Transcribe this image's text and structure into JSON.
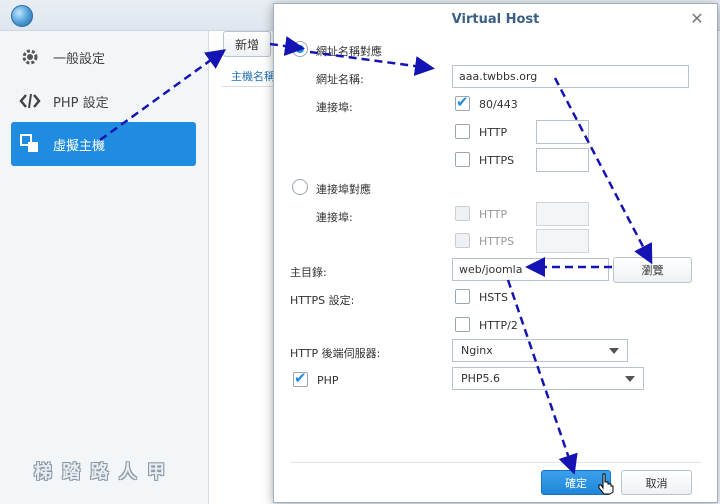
{
  "sidebar": {
    "items": [
      {
        "label": "一般設定",
        "icon": "gear-icon"
      },
      {
        "label": "PHP 設定",
        "icon": "code-icon"
      },
      {
        "label": "虛擬主機",
        "icon": "virtual-host-icon"
      }
    ]
  },
  "main": {
    "add_button": "新增",
    "column_header": "主機名稱"
  },
  "watermark": "梯 踏 路 人 甲",
  "dialog": {
    "title": "Virtual Host",
    "hostname_mode_label": "網址名稱對應",
    "hostname_label": "網址名稱:",
    "hostname_value": "aaa.twbbs.org",
    "port_label": "連接埠:",
    "port_8043": "80/443",
    "http": "HTTP",
    "https": "HTTPS",
    "port_mode_label": "連接埠對應",
    "port_label2": "連接埠:",
    "http2": "HTTP",
    "https2": "HTTPS",
    "docroot_label": "主目錄:",
    "docroot_value": "web/joomla",
    "browse_button": "瀏覽",
    "https_settings_label": "HTTPS 設定:",
    "hsts": "HSTS",
    "http2_proto": "HTTP/2",
    "backend_label": "HTTP 後端伺服器:",
    "backend_value": "Nginx",
    "php_label": "PHP",
    "php_value": "PHP5.6",
    "ok_button": "確定",
    "cancel_button": "取消"
  },
  "colors": {
    "accent": "#1f8ce0",
    "annotation_arrow": "#1414b4"
  }
}
